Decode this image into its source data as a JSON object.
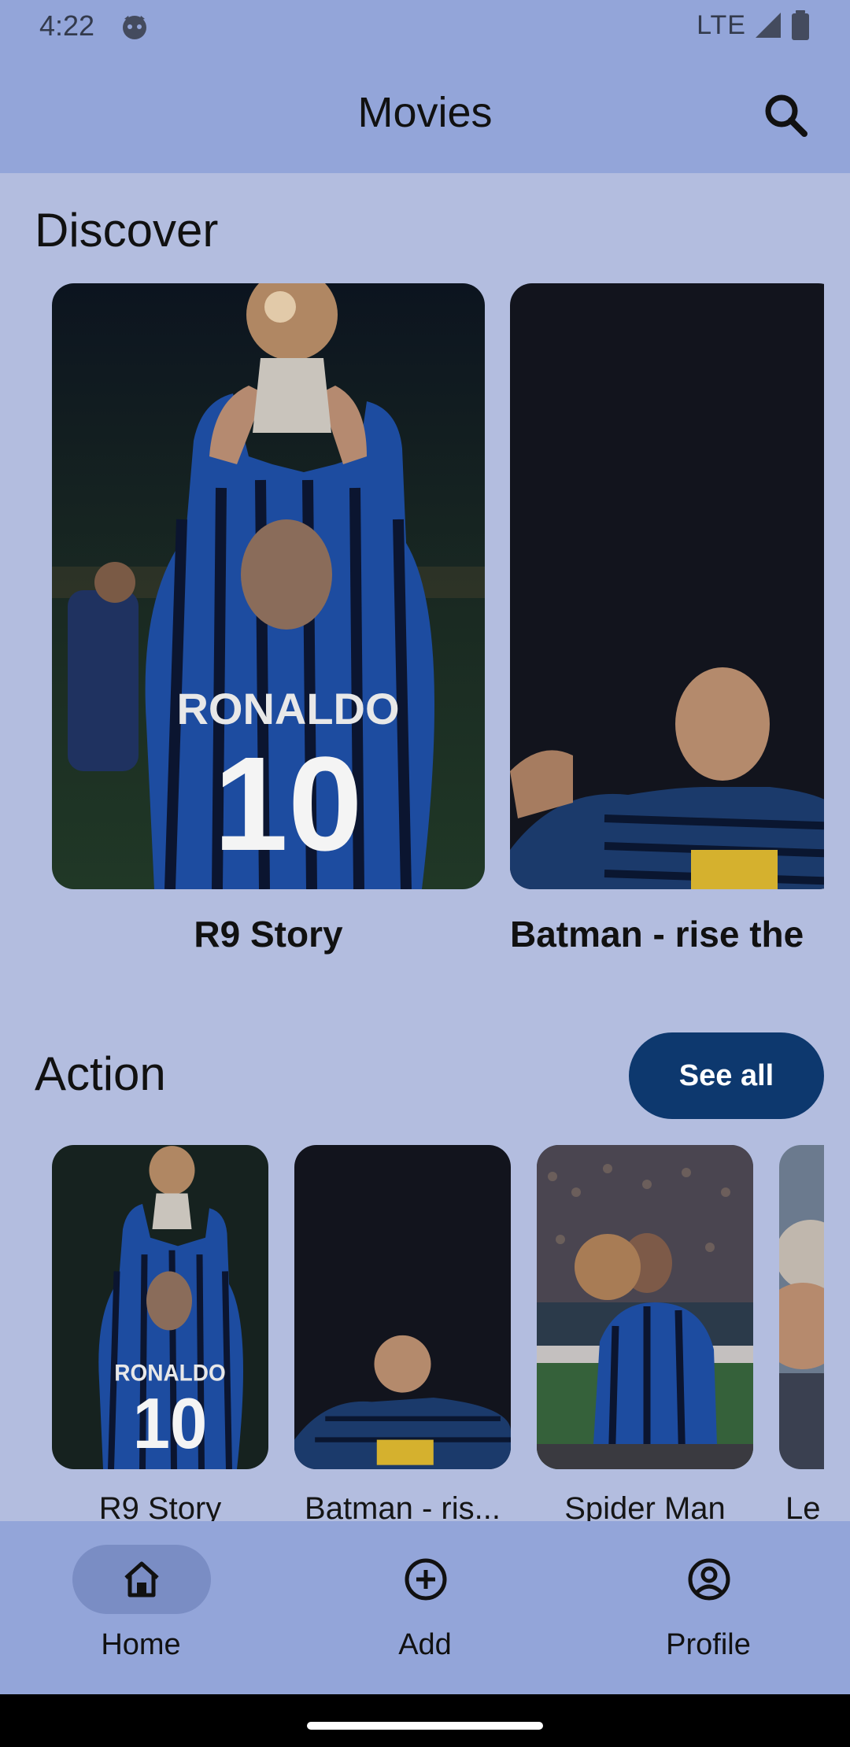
{
  "status_bar": {
    "time": "4:22",
    "network": "LTE"
  },
  "app_bar": {
    "title": "Movies",
    "search_icon": "search-icon"
  },
  "discover": {
    "title": "Discover",
    "cards": [
      {
        "title": "R9 Story"
      },
      {
        "title": "Batman - rise the"
      }
    ]
  },
  "action": {
    "title": "Action",
    "see_all_label": "See all",
    "cards": [
      {
        "title": "R9 Story"
      },
      {
        "title": "Batman - ris..."
      },
      {
        "title": "Spider Man"
      },
      {
        "title": "Le"
      }
    ]
  },
  "bottom_nav": {
    "items": [
      {
        "label": "Home",
        "icon": "home-icon",
        "active": true
      },
      {
        "label": "Add",
        "icon": "add-circle-icon",
        "active": false
      },
      {
        "label": "Profile",
        "icon": "profile-icon",
        "active": false
      }
    ]
  },
  "colors": {
    "background": "#b3bddf",
    "app_bar": "#93a5d9",
    "accent_button": "#0d386e",
    "nav_active_pill": "#7a8dc4"
  }
}
